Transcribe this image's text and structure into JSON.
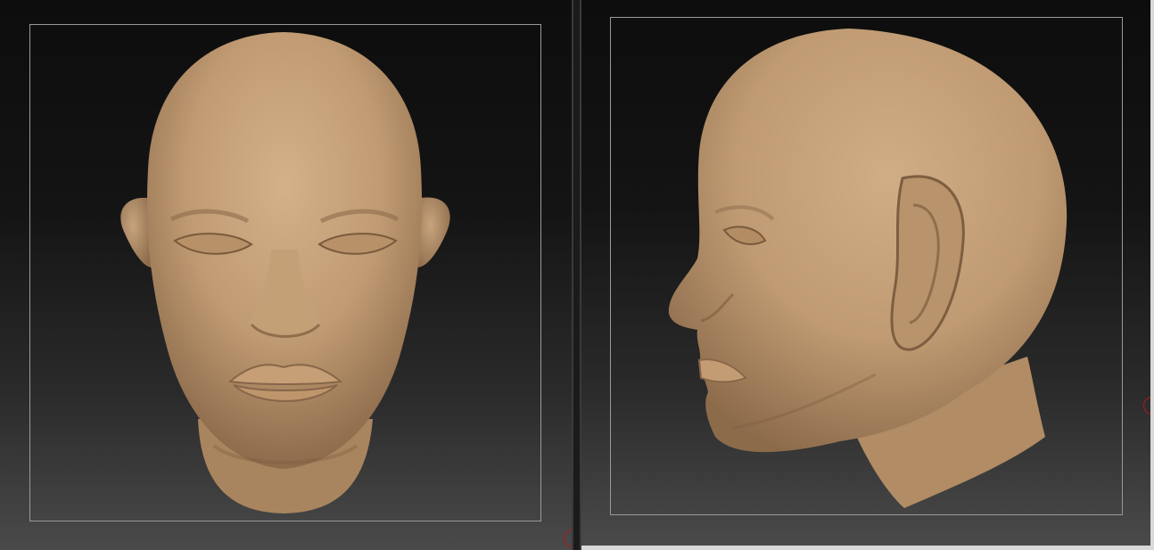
{
  "app": {
    "type": "3d-sculpting-dual-viewport"
  },
  "viewports": [
    {
      "id": "front",
      "view": "front",
      "model": "head",
      "model_color": "#c8a47c"
    },
    {
      "id": "side",
      "view": "left-profile",
      "model": "head",
      "model_color": "#c8a47c"
    }
  ],
  "colors": {
    "background_top": "#0d0d0d",
    "background_bottom": "#4a4a4a",
    "frame": "#9a9a9a",
    "model_base": "#c8a47c",
    "model_shadow": "#8a6a4a",
    "gizmo": "#b01818"
  },
  "icons": {
    "rotation_gizmo": "rotation-gizmo-icon"
  }
}
